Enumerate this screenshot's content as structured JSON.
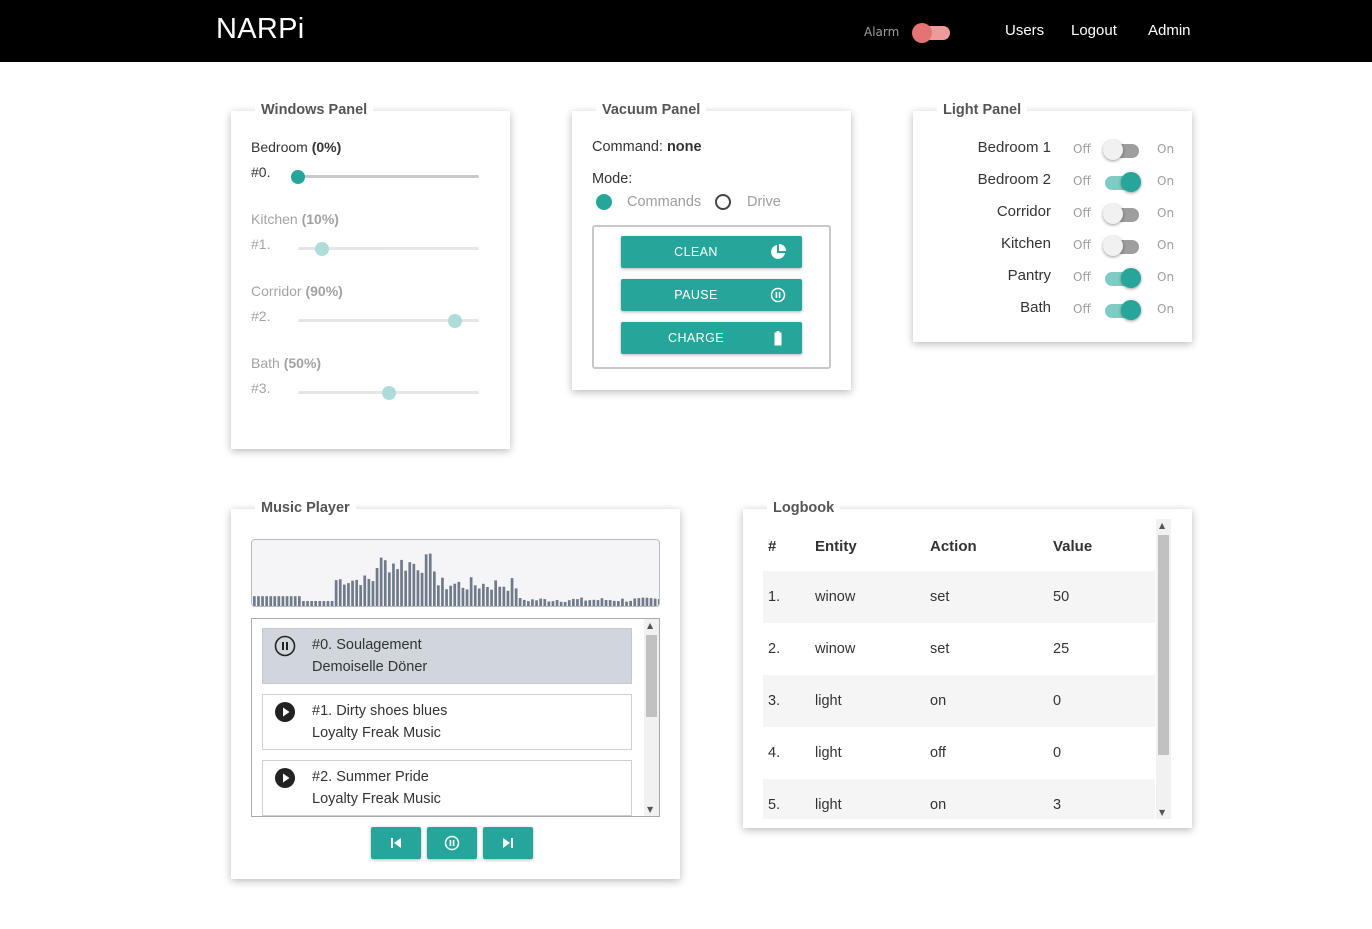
{
  "header": {
    "brand": "NARPi",
    "alarm_label": "Alarm",
    "alarm_on": true,
    "nav": [
      "Users",
      "Logout",
      "Admin"
    ]
  },
  "colors": {
    "accent": "#26a69a",
    "accent_light": "#80cbc4",
    "alarm": "#e57373",
    "header_bg": "#000000"
  },
  "windows_panel": {
    "title": "Windows Panel",
    "items": [
      {
        "name": "Bedroom",
        "percent_label": "(0%)",
        "index": "#0.",
        "value": 0,
        "enabled": true
      },
      {
        "name": "Kitchen",
        "percent_label": "(10%)",
        "index": "#1.",
        "value": 10,
        "enabled": false
      },
      {
        "name": "Corridor",
        "percent_label": "(90%)",
        "index": "#2.",
        "value": 90,
        "enabled": false
      },
      {
        "name": "Bath",
        "percent_label": "(50%)",
        "index": "#3.",
        "value": 50,
        "enabled": false
      }
    ]
  },
  "vacuum_panel": {
    "title": "Vacuum Panel",
    "command_label": "Command:",
    "command_value": "none",
    "mode_label": "Mode:",
    "modes": [
      {
        "label": "Commands",
        "selected": true
      },
      {
        "label": "Drive",
        "selected": false
      }
    ],
    "buttons": [
      {
        "label": "CLEAN",
        "icon": "pie-chart-icon"
      },
      {
        "label": "PAUSE",
        "icon": "pause-circle-icon"
      },
      {
        "label": "CHARGE",
        "icon": "battery-icon"
      }
    ]
  },
  "light_panel": {
    "title": "Light Panel",
    "off_label": "Off",
    "on_label": "On",
    "lights": [
      {
        "name": "Bedroom 1",
        "on": false
      },
      {
        "name": "Bedroom 2",
        "on": true
      },
      {
        "name": "Corridor",
        "on": false
      },
      {
        "name": "Kitchen",
        "on": false
      },
      {
        "name": "Pantry",
        "on": true
      },
      {
        "name": "Bath",
        "on": true
      }
    ]
  },
  "music_player": {
    "title": "Music Player",
    "tracks": [
      {
        "index": "#0.",
        "title": "Soulagement",
        "artist": "Demoiselle Döner",
        "playing": true
      },
      {
        "index": "#1.",
        "title": "Dirty shoes blues",
        "artist": "Loyalty Freak Music",
        "playing": false
      },
      {
        "index": "#2.",
        "title": "Summer Pride",
        "artist": "Loyalty Freak Music",
        "playing": false
      }
    ],
    "controls": [
      "skip-previous-icon",
      "pause-circle-icon",
      "skip-next-icon"
    ]
  },
  "logbook": {
    "title": "Logbook",
    "columns": [
      "#",
      "Entity",
      "Action",
      "Value"
    ],
    "rows": [
      [
        "1.",
        "winow",
        "set",
        "50"
      ],
      [
        "2.",
        "winow",
        "set",
        "25"
      ],
      [
        "3.",
        "light",
        "on",
        "0"
      ],
      [
        "4.",
        "light",
        "off",
        "0"
      ],
      [
        "5.",
        "light",
        "on",
        "3"
      ]
    ]
  }
}
